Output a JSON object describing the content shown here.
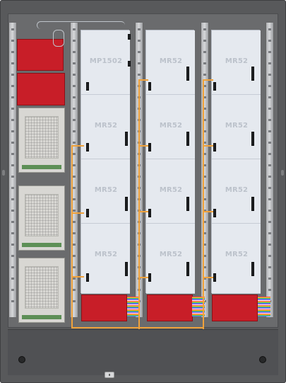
{
  "panel_titles": {
    "col1_row1": "MP1502",
    "col1_row2": "MR52",
    "col1_row3": "MR52",
    "col1_row4": "MR52",
    "col2_row1": "MR52",
    "col2_row2": "MR52",
    "col2_row3": "MR52",
    "col2_row4": "MR52",
    "col3_row1": "MR52",
    "col3_row2": "MR52",
    "col3_row3": "MR52",
    "col3_row4": "MR52"
  },
  "colors": {
    "cabinet": "#58595b",
    "panel": "#dde2ea",
    "wire_orange": "#f0a23b",
    "module_red": "#c81e28",
    "module_green": "#1d8a45"
  }
}
